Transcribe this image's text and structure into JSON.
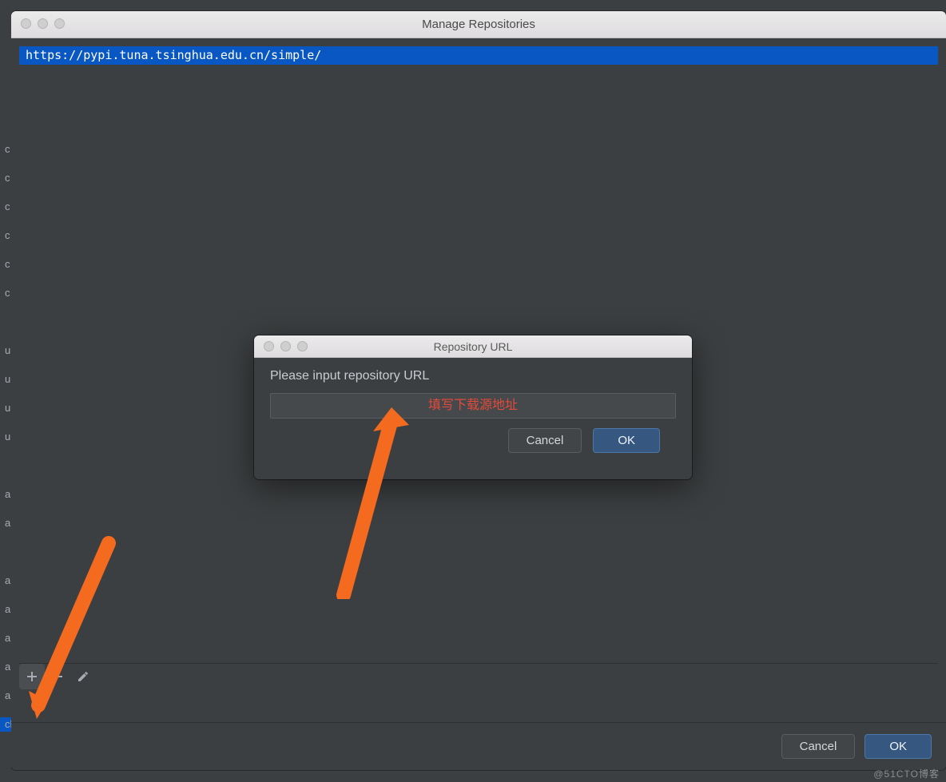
{
  "window": {
    "title": "Manage Repositories"
  },
  "repositories": [
    {
      "url": "https://pypi.tuna.tsinghua.edu.cn/simple/",
      "selected": true
    }
  ],
  "toolbar": {
    "add_icon": "plus-icon",
    "remove_icon": "minus-icon",
    "edit_icon": "pencil-icon"
  },
  "footer": {
    "cancel_label": "Cancel",
    "ok_label": "OK"
  },
  "modal": {
    "title": "Repository URL",
    "prompt": "Please input repository URL",
    "input_value": "",
    "overlay_annotation": "填写下载源地址",
    "cancel_label": "Cancel",
    "ok_label": "OK"
  },
  "watermark": "@51CTO博客"
}
